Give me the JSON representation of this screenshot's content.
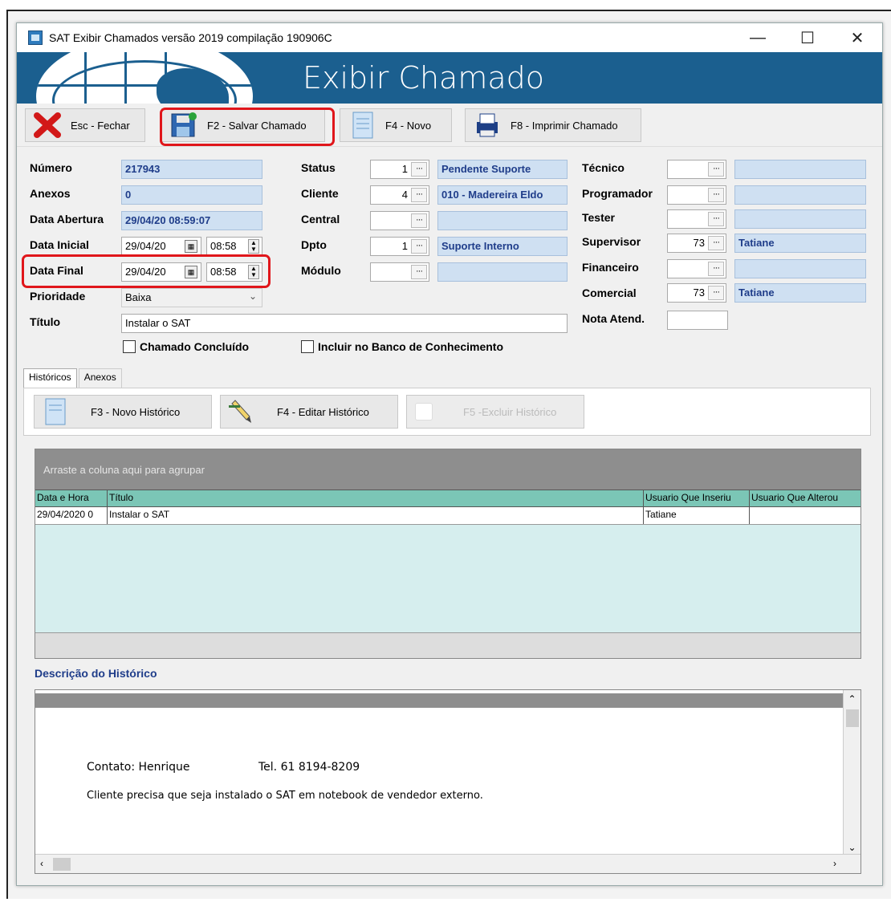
{
  "window": {
    "title": "SAT Exibir Chamados  versão 2019 compilação 190906C",
    "minimize": "—",
    "maximize": "☐",
    "close": "✕"
  },
  "banner": {
    "title": "Exibir Chamado"
  },
  "toolbar": {
    "close_label": "Esc - Fechar",
    "save_label": "F2 - Salvar Chamado",
    "new_label": "F4 - Novo",
    "print_label": "F8 - Imprimir Chamado"
  },
  "form": {
    "numero": {
      "label": "Número",
      "value": "217943"
    },
    "anexos": {
      "label": "Anexos",
      "value": "0"
    },
    "data_abertura": {
      "label": "Data Abertura",
      "value": "29/04/20 08:59:07"
    },
    "data_inicial": {
      "label": "Data Inicial",
      "date": "29/04/20",
      "time": "08:58"
    },
    "data_final": {
      "label": "Data Final",
      "date": "29/04/20",
      "time": "08:58"
    },
    "prioridade": {
      "label": "Prioridade",
      "value": "Baixa"
    },
    "titulo": {
      "label": "Título",
      "value": "Instalar o SAT"
    },
    "status": {
      "label": "Status",
      "code": "1",
      "desc": "Pendente Suporte"
    },
    "cliente": {
      "label": "Cliente",
      "code": "4",
      "desc": "010 - Madereira Eldo"
    },
    "central": {
      "label": "Central",
      "code": "",
      "desc": ""
    },
    "dpto": {
      "label": "Dpto",
      "code": "1",
      "desc": "Suporte Interno"
    },
    "modulo": {
      "label": "Módulo",
      "code": "",
      "desc": ""
    },
    "tecnico": {
      "label": "Técnico",
      "code": "",
      "desc": ""
    },
    "programador": {
      "label": "Programador",
      "code": "",
      "desc": ""
    },
    "tester": {
      "label": "Tester",
      "code": "",
      "desc": ""
    },
    "supervisor": {
      "label": "Supervisor",
      "code": "73",
      "desc": "Tatiane"
    },
    "financeiro": {
      "label": "Financeiro",
      "code": "",
      "desc": ""
    },
    "comercial": {
      "label": "Comercial",
      "code": "73",
      "desc": "Tatiane"
    },
    "nota": {
      "label": "Nota Atend.",
      "value": ""
    },
    "concluido_label": "Chamado Concluído",
    "banco_label": "Incluir no Banco de Conhecimento",
    "dots": "···"
  },
  "tabs": [
    "Históricos",
    "Anexos"
  ],
  "history_toolbar": {
    "new_label": "F3 - Novo Histórico",
    "edit_label": "F4 - Editar Histórico",
    "delete_label": "F5 -Excluir Histórico"
  },
  "grid": {
    "group_hint": "Arraste a coluna aqui para agrupar",
    "columns": [
      "Data e Hora",
      "Título",
      "Usuario Que Inseriu",
      "Usuario Que Alterou"
    ],
    "rows": [
      [
        "29/04/2020 0",
        "Instalar o SAT",
        "Tatiane",
        ""
      ]
    ]
  },
  "description": {
    "label": "Descrição do Histórico",
    "contato": "Contato: Henrique",
    "telefone": "Tel. 61 8194-8209",
    "texto": "Cliente precisa que seja instalado o SAT em notebook de vendedor externo."
  },
  "colors": {
    "banner": "#1b5f8f",
    "highlight": "#e0161b",
    "grid_header": "#7bc6b6",
    "blue_field": "#cfe0f2"
  }
}
